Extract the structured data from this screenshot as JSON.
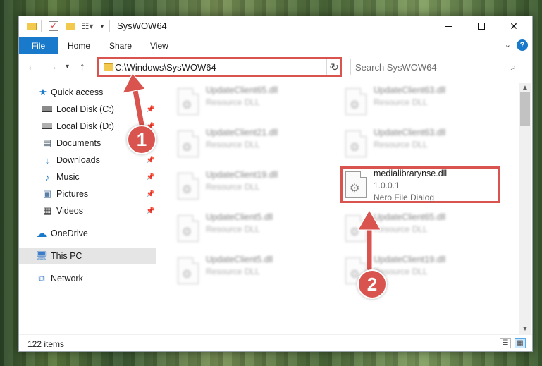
{
  "window": {
    "title": "SysWOW64",
    "minimize_label": "—",
    "close_label": "✕"
  },
  "ribbon": {
    "tabs": [
      "File",
      "Home",
      "Share",
      "View"
    ],
    "help_label": "?"
  },
  "address_bar": {
    "path": "C:\\Windows\\SysWOW64",
    "search_placeholder": "Search SysWOW64"
  },
  "sidebar": {
    "items": [
      {
        "label": "Quick access",
        "icon": "star-icon",
        "pinned": false
      },
      {
        "label": "Local Disk (C:)",
        "icon": "drive-icon",
        "pinned": true
      },
      {
        "label": "Local Disk (D:)",
        "icon": "drive-icon",
        "pinned": true
      },
      {
        "label": "Documents",
        "icon": "document-icon",
        "pinned": true
      },
      {
        "label": "Downloads",
        "icon": "download-icon",
        "pinned": true
      },
      {
        "label": "Music",
        "icon": "music-icon",
        "pinned": true
      },
      {
        "label": "Pictures",
        "icon": "pictures-icon",
        "pinned": true
      },
      {
        "label": "Videos",
        "icon": "videos-icon",
        "pinned": true
      },
      {
        "label": "OneDrive",
        "icon": "cloud-icon",
        "pinned": false
      },
      {
        "label": "This PC",
        "icon": "computer-icon",
        "pinned": false,
        "selected": true
      },
      {
        "label": "Network",
        "icon": "network-icon",
        "pinned": false
      }
    ]
  },
  "files": {
    "left": [
      {
        "name": "UpdateClient65.dll",
        "type": "Resource DLL"
      },
      {
        "name": "UpdateClient21.dll",
        "type": "Resource DLL"
      },
      {
        "name": "UpdateClient19.dll",
        "type": "Resource DLL"
      },
      {
        "name": "UpdateClient5.dll",
        "type": "Resource DLL"
      },
      {
        "name": "UpdateClient5.dll",
        "type": "Resource DLL"
      }
    ],
    "right": [
      {
        "name": "UpdateClient63.dll",
        "type": "Resource DLL"
      },
      {
        "name": "UpdateClient63.dll",
        "type": "Resource DLL"
      },
      {
        "name": "medialibrarynse.dll",
        "version": "1.0.0.1",
        "description": "Nero File Dialog",
        "highlighted": true
      },
      {
        "name": "UpdateClient65.dll",
        "type": "Resource DLL"
      },
      {
        "name": "UpdateClient19.dll",
        "type": "Resource DLL"
      }
    ]
  },
  "status_bar": {
    "item_count": "122 items"
  },
  "annotations": {
    "step1": "1",
    "step2": "2"
  },
  "colors": {
    "accent": "#1979ca",
    "annotation_red": "#d9534f"
  }
}
